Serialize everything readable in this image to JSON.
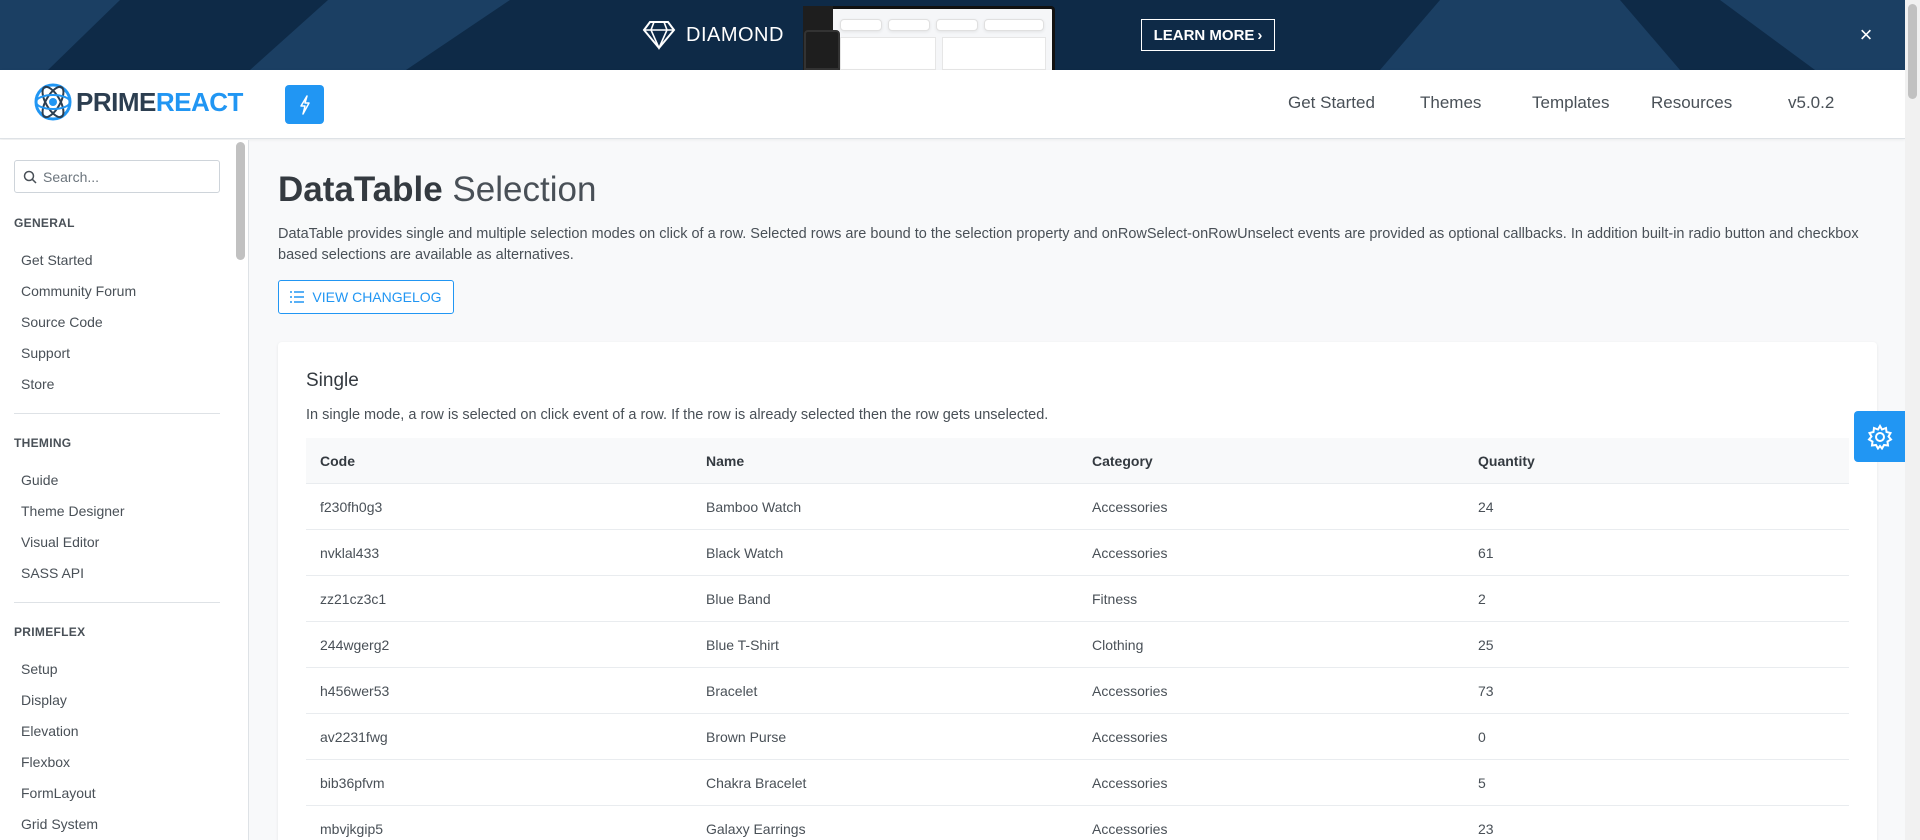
{
  "banner": {
    "title": "DIAMOND",
    "cta_label": "LEARN MORE",
    "close_label": "×"
  },
  "header": {
    "logo_part1": "PRIME",
    "logo_part2": "REACT",
    "nav": [
      "Get Started",
      "Themes",
      "Templates",
      "Resources",
      "v5.0.2"
    ]
  },
  "sidebar": {
    "search_placeholder": "Search...",
    "sections": [
      {
        "title": "GENERAL",
        "items": [
          "Get Started",
          "Community Forum",
          "Source Code",
          "Support",
          "Store"
        ]
      },
      {
        "title": "THEMING",
        "items": [
          "Guide",
          "Theme Designer",
          "Visual Editor",
          "SASS API"
        ]
      },
      {
        "title": "PRIMEFLEX",
        "items": [
          "Setup",
          "Display",
          "Elevation",
          "Flexbox",
          "FormLayout",
          "Grid System"
        ]
      }
    ]
  },
  "main": {
    "title_bold": "DataTable",
    "title_light": "Selection",
    "description": "DataTable provides single and multiple selection modes on click of a row. Selected rows are bound to the selection property and onRowSelect-onRowUnselect events are provided as optional callbacks. In addition built-in radio button and checkbox based selections are available as alternatives.",
    "changelog_label": "VIEW CHANGELOG"
  },
  "card": {
    "title": "Single",
    "description": "In single mode, a row is selected on click event of a row. If the row is already selected then the row gets unselected.",
    "columns": [
      "Code",
      "Name",
      "Category",
      "Quantity"
    ],
    "rows": [
      [
        "f230fh0g3",
        "Bamboo Watch",
        "Accessories",
        "24"
      ],
      [
        "nvklal433",
        "Black Watch",
        "Accessories",
        "61"
      ],
      [
        "zz21cz3c1",
        "Blue Band",
        "Fitness",
        "2"
      ],
      [
        "244wgerg2",
        "Blue T-Shirt",
        "Clothing",
        "25"
      ],
      [
        "h456wer53",
        "Bracelet",
        "Accessories",
        "73"
      ],
      [
        "av2231fwg",
        "Brown Purse",
        "Accessories",
        "0"
      ],
      [
        "bib36pfvm",
        "Chakra Bracelet",
        "Accessories",
        "5"
      ],
      [
        "mbvjkgip5",
        "Galaxy Earrings",
        "Accessories",
        "23"
      ]
    ]
  },
  "colors": {
    "primary": "#2196f3",
    "banner_bg": "#0e2a47",
    "text": "#495057"
  },
  "icons": [
    "diamond-icon",
    "close-icon",
    "logo-icon",
    "bolt-icon",
    "search-icon",
    "list-icon",
    "gear-icon"
  ]
}
